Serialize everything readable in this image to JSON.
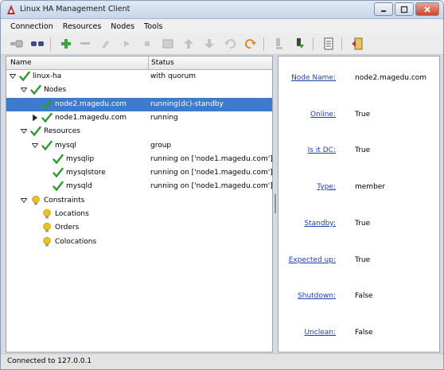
{
  "window": {
    "title": "Linux HA Management Client",
    "controls": [
      "minimize",
      "maximize",
      "close"
    ]
  },
  "menu": [
    "Connection",
    "Resources",
    "Nodes",
    "Tools"
  ],
  "toolbar": {
    "icons": [
      "connect-icon",
      "disconnect-icon",
      "add-icon",
      "remove-icon",
      "cleanup-icon",
      "start-icon",
      "stop-icon",
      "default-icon",
      "move-up-icon",
      "move-down-icon",
      "undo-icon",
      "redo-icon",
      "standby-icon",
      "active-icon",
      "log-icon",
      "exit-icon"
    ]
  },
  "tree": {
    "columns": {
      "name": "Name",
      "status": "Status"
    },
    "rows": [
      {
        "label": "linux-ha",
        "status": "with quorum",
        "icon": "check-icon",
        "expander": "expanded"
      },
      {
        "label": "Nodes",
        "status": "",
        "icon": "check-icon",
        "expander": "expanded"
      },
      {
        "label": "node2.magedu.com",
        "status": "running(dc)-standby",
        "icon": "check-icon",
        "expander": "none",
        "selected": true
      },
      {
        "label": "node1.magedu.com",
        "status": "running",
        "icon": "check-icon",
        "expander": "collapsed"
      },
      {
        "label": "Resources",
        "status": "",
        "icon": "check-icon",
        "expander": "expanded"
      },
      {
        "label": "mysql",
        "status": "group",
        "icon": "check-icon",
        "expander": "expanded"
      },
      {
        "label": "mysqlip",
        "status": "running on ['node1.magedu.com']",
        "icon": "check-icon",
        "expander": "none"
      },
      {
        "label": "mysqlstore",
        "status": "running on ['node1.magedu.com']",
        "icon": "check-icon",
        "expander": "none"
      },
      {
        "label": "mysqld",
        "status": "running on ['node1.magedu.com']",
        "icon": "check-icon",
        "expander": "none"
      },
      {
        "label": "Constraints",
        "status": "",
        "icon": "lightbulb-icon",
        "expander": "expanded"
      },
      {
        "label": "Locations",
        "status": "",
        "icon": "lightbulb-icon",
        "expander": "none"
      },
      {
        "label": "Orders",
        "status": "",
        "icon": "lightbulb-icon",
        "expander": "none"
      },
      {
        "label": "Colocations",
        "status": "",
        "icon": "lightbulb-icon",
        "expander": "none"
      }
    ]
  },
  "details": [
    {
      "label": "Node Name:",
      "value": "node2.magedu.com"
    },
    {
      "label": "Online:",
      "value": "True"
    },
    {
      "label": "Is it DC:",
      "value": "True"
    },
    {
      "label": "Type:",
      "value": "member"
    },
    {
      "label": "Standby:",
      "value": "True"
    },
    {
      "label": "Expected up:",
      "value": "True"
    },
    {
      "label": "Shutdown:",
      "value": "False"
    },
    {
      "label": "Unclean:",
      "value": "False"
    }
  ],
  "statusbar": {
    "text": "Connected to 127.0.0.1"
  },
  "colors": {
    "selection": "#3e7ace",
    "check": "#2e9a2e",
    "link": "#1d3fb5",
    "bulb": "#f2c21a"
  }
}
